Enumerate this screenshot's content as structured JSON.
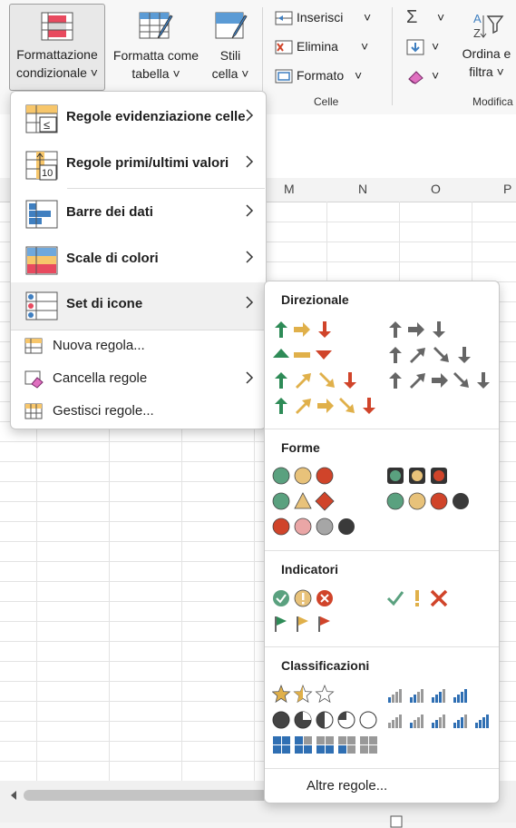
{
  "ribbon": {
    "cond_format_line1": "Formattazione",
    "cond_format_line2": "condizionale",
    "format_table_line1": "Formatta come",
    "format_table_line2": "tabella",
    "styles_line1": "Stili",
    "styles_line2": "cella",
    "insert": "Inserisci",
    "delete": "Elimina",
    "format": "Formato",
    "group_cells": "Celle",
    "sort_line1": "Ordina e",
    "sort_line2": "filtra",
    "group_edit": "Modifica",
    "chevron": "˅"
  },
  "columns": [
    "M",
    "N",
    "O",
    "P"
  ],
  "cf_menu": {
    "highlight_rules": "Regole evidenziazione celle",
    "top_bottom_rules": "Regole primi/ultimi valori",
    "data_bars": "Barre dei dati",
    "color_scales": "Scale di colori",
    "icon_sets": "Set di icone",
    "new_rule": "Nuova regola...",
    "clear_rules": "Cancella regole",
    "manage_rules": "Gestisci regole..."
  },
  "icon_menu": {
    "directional": "Direzionale",
    "shapes": "Forme",
    "indicators": "Indicatori",
    "ratings": "Classificazioni",
    "more_rules": "Altre regole..."
  },
  "colors": {
    "green": "#2e8b57",
    "yellow": "#e0b04a",
    "red": "#d0442a",
    "gray": "#666666",
    "blue": "#2f6fb3",
    "excel_green": "#217346"
  }
}
